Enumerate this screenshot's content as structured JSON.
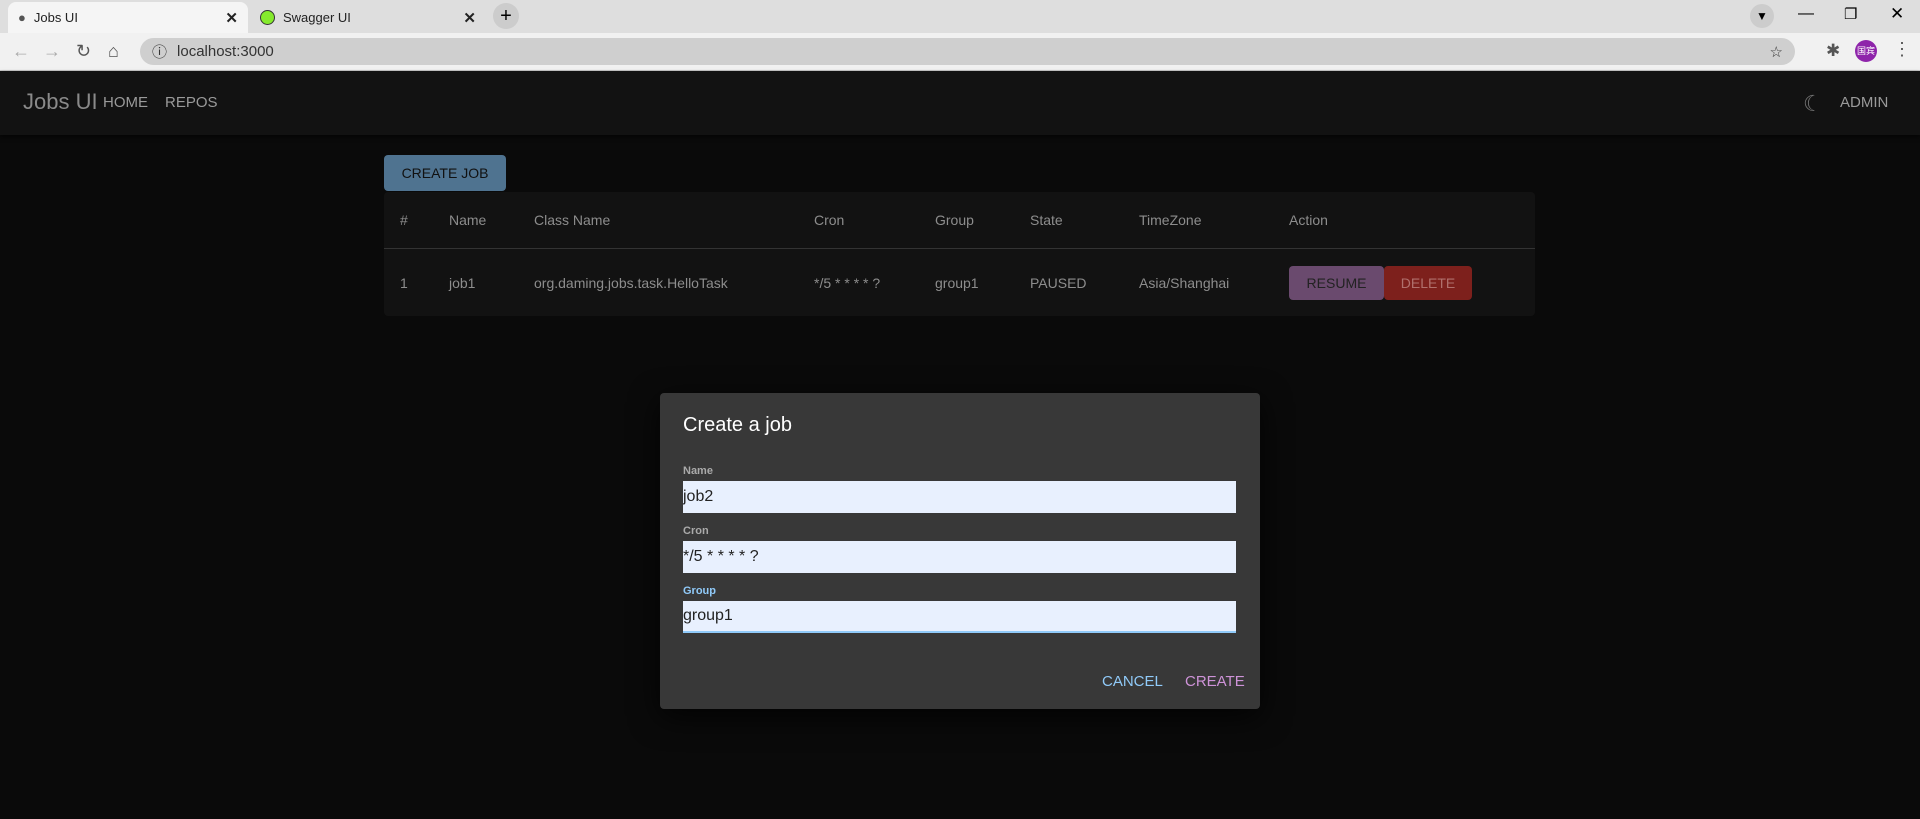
{
  "browser": {
    "tabs": [
      {
        "title": "Jobs UI",
        "icon": "globe-icon"
      },
      {
        "title": "Swagger UI",
        "icon": "swagger-icon"
      }
    ],
    "url": "localhost:3000",
    "profile_label": "国宾"
  },
  "appbar": {
    "title": "Jobs UI",
    "nav": [
      "HOME",
      "REPOS"
    ],
    "user": "ADMIN",
    "theme_icon": "moon-icon"
  },
  "create_job_label": "CREATE JOB",
  "table": {
    "headers": [
      "#",
      "Name",
      "Class Name",
      "Cron",
      "Group",
      "State",
      "TimeZone",
      "Action"
    ],
    "rows": [
      {
        "num": "1",
        "name": "job1",
        "class_name": "org.daming.jobs.task.HelloTask",
        "cron": "*/5 * * * * ?",
        "group": "group1",
        "state": "PAUSED",
        "timezone": "Asia/Shanghai",
        "actions": [
          "RESUME",
          "DELETE"
        ]
      }
    ]
  },
  "dialog": {
    "title": "Create a job",
    "fields": [
      {
        "label": "Name",
        "value": "job2"
      },
      {
        "label": "Cron",
        "value": "*/5 * * * * ?"
      },
      {
        "label": "Group",
        "value": "group1"
      }
    ],
    "cancel": "CANCEL",
    "create": "CREATE"
  },
  "colors": {
    "primary": "#4f7390",
    "resume": "#6a4a6e",
    "delete": "#7d201c",
    "focus": "#90caf9",
    "create_text": "#ce93d8"
  }
}
